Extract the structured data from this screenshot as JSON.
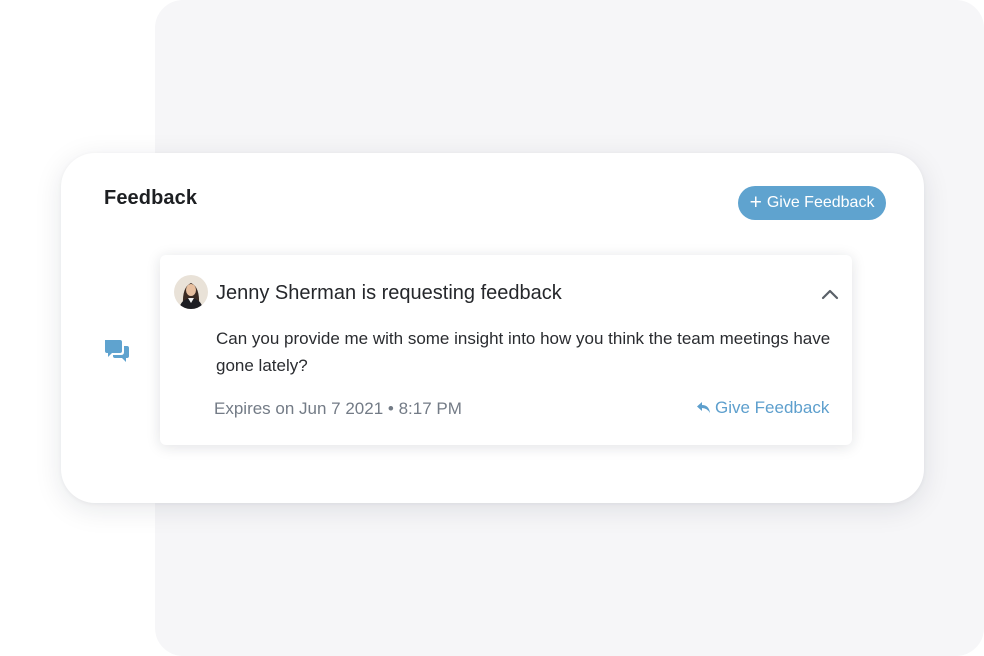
{
  "panel": {
    "title": "Feedback",
    "give_button": {
      "icon": "plus-icon",
      "label": "Give Feedback"
    }
  },
  "request": {
    "chat_icon": "chat-bubbles-icon",
    "avatar_icon": "avatar",
    "requester_line": "Jenny Sherman is requesting feedback",
    "collapse_icon": "chevron-up-icon",
    "message": "Can you provide me with some insight into how you think the team meetings have gone lately?",
    "expires": "Expires on Jun 7 2021 • 8:17 PM",
    "reply": {
      "icon": "reply-icon",
      "label": "Give Feedback"
    }
  },
  "colors": {
    "accent": "#5fa3cf",
    "link": "#5d9fcd",
    "backdrop": "#f6f6f8",
    "muted_text": "#737b86"
  }
}
